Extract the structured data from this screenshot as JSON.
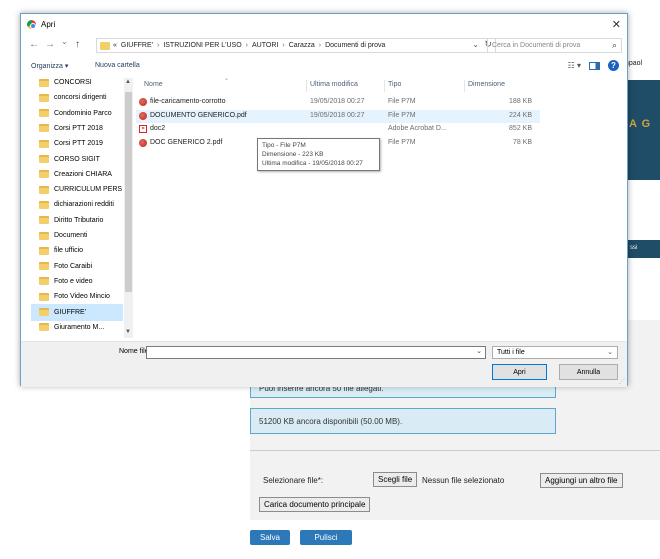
{
  "background": {
    "top_right_text": "mpaol",
    "banner_letters": "A G",
    "band_text": "ssi",
    "info_box_1": "Puoi inserire ancora 50 file allegati.",
    "info_box_2": "51200 KB ancora disponibili (50.00 MB).",
    "select_label": "Selezionare file*:",
    "choose_button": "Scegli file",
    "no_file_text": "Nessun file selezionato",
    "add_file_button": "Aggiungi un altro file",
    "upload_main_button": "Carica documento principale",
    "save_button": "Salva",
    "clear_button": "Pulisci"
  },
  "dialog": {
    "title": "Apri",
    "close": "✕",
    "nav": {
      "back": "←",
      "forward": "→",
      "recent": "⌄",
      "up": "↑"
    },
    "breadcrumbs": [
      "«",
      "GIUFFRE'",
      "ISTRUZIONI PER L'USO",
      "AUTORI",
      "Carazza",
      "Documenti di prova"
    ],
    "search_placeholder": "Cerca in Documenti di prova",
    "toolbar": {
      "organize": "Organizza ▾",
      "new_folder": "Nuova cartella",
      "view_icon": "☷ ▾",
      "help": "?"
    },
    "nav_items": [
      {
        "label": "CONCORSI",
        "selected": false
      },
      {
        "label": "concorsi dirigenti",
        "selected": false
      },
      {
        "label": "Condominio Parco",
        "selected": false
      },
      {
        "label": "Corsi PTT 2018",
        "selected": false
      },
      {
        "label": "Corsi PTT 2019",
        "selected": false
      },
      {
        "label": "CORSO SIGIT",
        "selected": false
      },
      {
        "label": "Creazioni CHIARA",
        "selected": false
      },
      {
        "label": "CURRICULUM PERS",
        "selected": false
      },
      {
        "label": "dichiarazioni redditi",
        "selected": false
      },
      {
        "label": "Diritto Tributario",
        "selected": false
      },
      {
        "label": "Documenti",
        "selected": false
      },
      {
        "label": "file ufficio",
        "selected": false
      },
      {
        "label": "Foto Caraibi",
        "selected": false
      },
      {
        "label": "Foto e video",
        "selected": false
      },
      {
        "label": "Foto Video Mincio",
        "selected": false
      },
      {
        "label": "GIUFFRE'",
        "selected": true
      },
      {
        "label": "Giuramento M...",
        "selected": false
      }
    ],
    "columns": {
      "name": "Nome",
      "modified": "Ultima modifica",
      "type": "Tipo",
      "size": "Dimensione"
    },
    "files": [
      {
        "name": "file-caricamento-corrotto",
        "modified": "19/05/2018 00:27",
        "type": "File P7M",
        "size": "188 KB",
        "icon": "p7m"
      },
      {
        "name": "DOCUMENTO GENERICO.pdf",
        "modified": "19/05/2018 00:27",
        "type": "File P7M",
        "size": "224 KB",
        "icon": "p7m"
      },
      {
        "name": "doc2",
        "modified": "",
        "type": "Adobe Acrobat D...",
        "size": "852 KB",
        "icon": "pdf"
      },
      {
        "name": "DOC GENERICO 2.pdf",
        "modified": "",
        "type": "File P7M",
        "size": "78 KB",
        "icon": "p7m"
      }
    ],
    "tooltip": {
      "line1": "Tipo - File P7M",
      "line2": "Dimensione - 223 KB",
      "line3": "Ultima modifica - 19/05/2018 00:27"
    },
    "filename_label": "Nome file:",
    "filename_value": "",
    "filter": "Tutti i file",
    "open_button": "Apri",
    "cancel_button": "Annulla"
  }
}
